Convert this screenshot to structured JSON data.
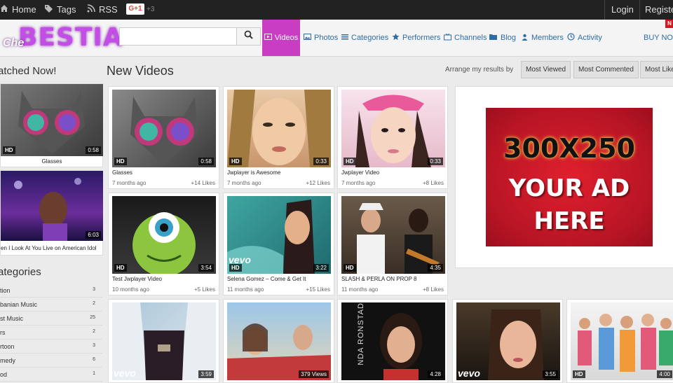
{
  "topbar": {
    "home": "Home",
    "tags": "Tags",
    "rss": "RSS",
    "gplus": "G+1",
    "gplus_count": "+3",
    "login": "Login",
    "register": "Registe"
  },
  "header": {
    "logo_small": "Che",
    "logo_big": "BESTIA",
    "search_placeholder": "",
    "nav": [
      {
        "label": "Videos",
        "icon": "video-icon",
        "active": true
      },
      {
        "label": "Photos",
        "icon": "photo-icon"
      },
      {
        "label": "Categories",
        "icon": "list-icon"
      },
      {
        "label": "Performers",
        "icon": "star-icon"
      },
      {
        "label": "Channels",
        "icon": "tv-icon"
      },
      {
        "label": "Blog",
        "icon": "folder-icon"
      },
      {
        "label": "Members",
        "icon": "members-icon"
      },
      {
        "label": "Activity",
        "icon": "clock-icon"
      }
    ],
    "buy_now": "BUY NO",
    "new_badge": "N"
  },
  "sidebar": {
    "watched_title": "atched Now!",
    "watched": [
      {
        "title": "Glasses",
        "duration": "0:58",
        "hd": "HD"
      },
      {
        "title": "en I Look At You Live on American Idol",
        "duration": "6:03"
      }
    ],
    "categories_title": "ategories",
    "categories": [
      {
        "name": "tion",
        "count": "3"
      },
      {
        "name": "banian Music",
        "count": "2"
      },
      {
        "name": "st Music",
        "count": "25"
      },
      {
        "name": "rs",
        "count": "2"
      },
      {
        "name": "rtoon",
        "count": "3"
      },
      {
        "name": "medy",
        "count": "6"
      },
      {
        "name": "od",
        "count": "1"
      }
    ]
  },
  "main": {
    "title": "New Videos",
    "arrange_label": "Arrange my results by",
    "sort_buttons": [
      "Most Viewed",
      "Most Commented",
      "Most Like"
    ],
    "videos": [
      {
        "title": "Glasses",
        "age": "7 months ago",
        "likes": "+14 Likes",
        "duration": "0:58",
        "hd": "HD"
      },
      {
        "title": "Jwplayer is Awesome",
        "age": "7 months ago",
        "likes": "+12 Likes",
        "duration": "0:33",
        "hd": "HD"
      },
      {
        "title": "Jwplayer Video",
        "age": "7 months ago",
        "likes": "+8 Likes",
        "duration": "0:33",
        "hd": "HD"
      },
      {
        "title": "Test Jwplayer Video",
        "age": "10 months ago",
        "likes": "+5 Likes",
        "duration": "3:54",
        "hd": "HD"
      },
      {
        "title": "Selena Gomez – Come & Get It",
        "age": "11 months ago",
        "likes": "+15 Likes",
        "duration": "3:22",
        "hd": "HD",
        "vevo": "vevo"
      },
      {
        "title": "SLASH & PERLA ON PROP 8",
        "age": "11 months ago",
        "likes": "+8 Likes",
        "duration": "4:35",
        "hd": "HD"
      }
    ],
    "row3": [
      {
        "duration": "3:59",
        "vevo": "vevo"
      },
      {
        "views": "379 Views"
      },
      {
        "duration": "4:28",
        "text": "NDA RONSTAD"
      },
      {
        "duration": "3:55",
        "vevo": "vevo"
      },
      {
        "duration": "4:00",
        "hd": "HD"
      }
    ]
  },
  "ad": {
    "line1": "300X250",
    "line2": "YOUR AD",
    "line3": "HERE"
  }
}
